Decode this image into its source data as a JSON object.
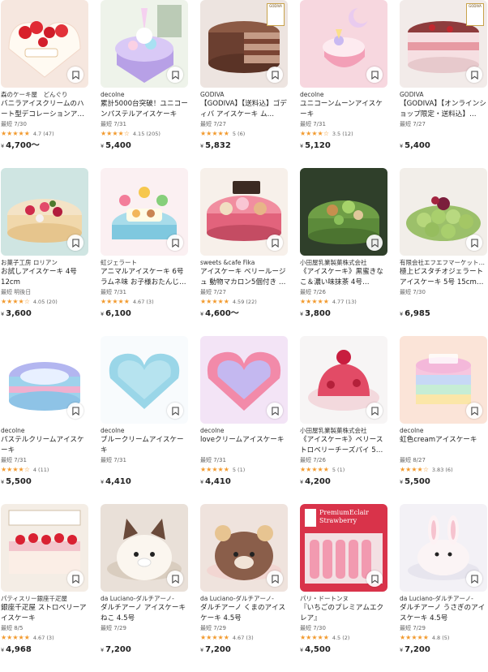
{
  "products": [
    {
      "seller": "森のケーキ屋　どんぐり",
      "title": "バニラアイスクリームのハート型デコレーションア…",
      "ship": "最短 7/30",
      "stars": 4.7,
      "rating": "4.7 (47)",
      "price": "4,700〜",
      "theme": "strawberry"
    },
    {
      "seller": "decolne",
      "title": "累計5000台突破！ユニコーンパステルアイスケーキ",
      "ship": "最短 7/31",
      "stars": 4.15,
      "rating": "4.15 (205)",
      "price": "5,400",
      "theme": "unicorn"
    },
    {
      "seller": "GODIVA",
      "title": "【GODIVA】【送料込】ゴディバ アイスケーキ ム…",
      "ship": "最短 7/27",
      "stars": 5,
      "rating": "5 (6)",
      "price": "5,832",
      "theme": "chocolate",
      "badge": "GODIVA"
    },
    {
      "seller": "decolne",
      "title": "ユニコーンムーンアイスケーキ",
      "ship": "最短 7/31",
      "stars": 3.5,
      "rating": "3.5 (12)",
      "price": "5,120",
      "theme": "moon"
    },
    {
      "seller": "GODIVA",
      "title": "【GODIVA】【オンラインショップ限定・送料込】…",
      "ship": "最短 7/27",
      "stars": 0,
      "rating": "",
      "price": "5,400",
      "theme": "berrycake",
      "badge": "GODIVA"
    },
    {
      "seller": "お菓子工房 ロリアン",
      "title": "お試しアイスケーキ 4号 12cm",
      "ship": "最短 明後日",
      "stars": 4.05,
      "rating": "4.05 (20)",
      "price": "3,600",
      "theme": "fruit"
    },
    {
      "seller": "虹ジェラート",
      "title": "アニマルアイスケーキ 6号 ラムネ味 お子様おたんじ…",
      "ship": "最短 7/31",
      "stars": 4.67,
      "rating": "4.67 (3)",
      "price": "6,100",
      "theme": "animal"
    },
    {
      "seller": "sweets &cafe Fika",
      "title": "アイスケーキ ベリールージュ 動物マカロン5個付き …",
      "ship": "最短 7/27",
      "stars": 4.59,
      "rating": "4.59 (22)",
      "price": "4,600〜",
      "theme": "macaron"
    },
    {
      "seller": "小田屋乳業製菓株式会社",
      "title": "《アイスケーキ》黒蜜きなこ＆濃い味抹茶 4号 12cm…",
      "ship": "最短 7/26",
      "stars": 4.77,
      "rating": "4.77 (13)",
      "price": "3,800",
      "theme": "matcha"
    },
    {
      "seller": "有限会社エフエフマーケット…",
      "title": "極上ピスタチオジェラート アイスケーキ 5号 15cm径…",
      "ship": "最短 7/30",
      "stars": 0,
      "rating": "",
      "price": "6,985",
      "theme": "pistachio"
    },
    {
      "seller": "decolne",
      "title": "パステルクリームアイスケーキ",
      "ship": "最短 7/31",
      "stars": 4,
      "rating": "4 (11)",
      "price": "5,500",
      "theme": "pastelblue"
    },
    {
      "seller": "decolne",
      "title": "ブルークリームアイスケーキ",
      "ship": "最短 7/31",
      "stars": 0,
      "rating": "",
      "price": "4,410",
      "theme": "blueheart"
    },
    {
      "seller": "decolne",
      "title": "loveクリームアイスケーキ",
      "ship": "最短 7/31",
      "stars": 5,
      "rating": "5 (1)",
      "price": "4,410",
      "theme": "pinkheart"
    },
    {
      "seller": "小田屋乳業製菓株式会社",
      "title": "《アイスケーキ》ベリーストロベリーチーズパイ 5…",
      "ship": "最短 7/26",
      "stars": 5,
      "rating": "5 (1)",
      "price": "4,200",
      "theme": "berrydome"
    },
    {
      "seller": "decolne",
      "title": "虹色creamアイスケーキ",
      "ship": "最短 8/27",
      "stars": 3.83,
      "rating": "3.83 (6)",
      "price": "5,500",
      "theme": "rainbow"
    },
    {
      "seller": "パティスリー銀座千疋屋",
      "title": "銀座千疋屋 ストロベリーアイスケーキ",
      "ship": "最短 8/5",
      "stars": 4.67,
      "rating": "4.67 (3)",
      "price": "4,968",
      "theme": "senbikiya"
    },
    {
      "seller": "da Luciano-ダルチアーノ-",
      "title": "ダルチアーノ アイスケーキ ねこ 4.5号",
      "ship": "最短 7/29",
      "stars": 0,
      "rating": "",
      "price": "7,200",
      "theme": "cat"
    },
    {
      "seller": "da Luciano-ダルチアーノ-",
      "title": "ダルチアーノ くまのアイスケーキ 4.5号",
      "ship": "最短 7/29",
      "stars": 4.67,
      "rating": "4.67 (3)",
      "price": "7,200",
      "theme": "bear"
    },
    {
      "seller": "パリ・ドートンヌ",
      "title": "『いちごのプレミアムエクレア』",
      "ship": "最短 7/30",
      "stars": 4.5,
      "rating": "4.5 (2)",
      "price": "4,500",
      "theme": "eclair",
      "imgtext": "PremiumEclair Strawberry"
    },
    {
      "seller": "da Luciano-ダルチアーノ-",
      "title": "ダルチアーノ うさぎのアイスケーキ 4.5号",
      "ship": "最短 7/29",
      "stars": 4.8,
      "rating": "4.8 (5)",
      "price": "7,200",
      "theme": "rabbit"
    }
  ],
  "currency": "¥",
  "colors": {
    "star": "#f29a2e",
    "text": "#222222",
    "meta": "#666666"
  }
}
